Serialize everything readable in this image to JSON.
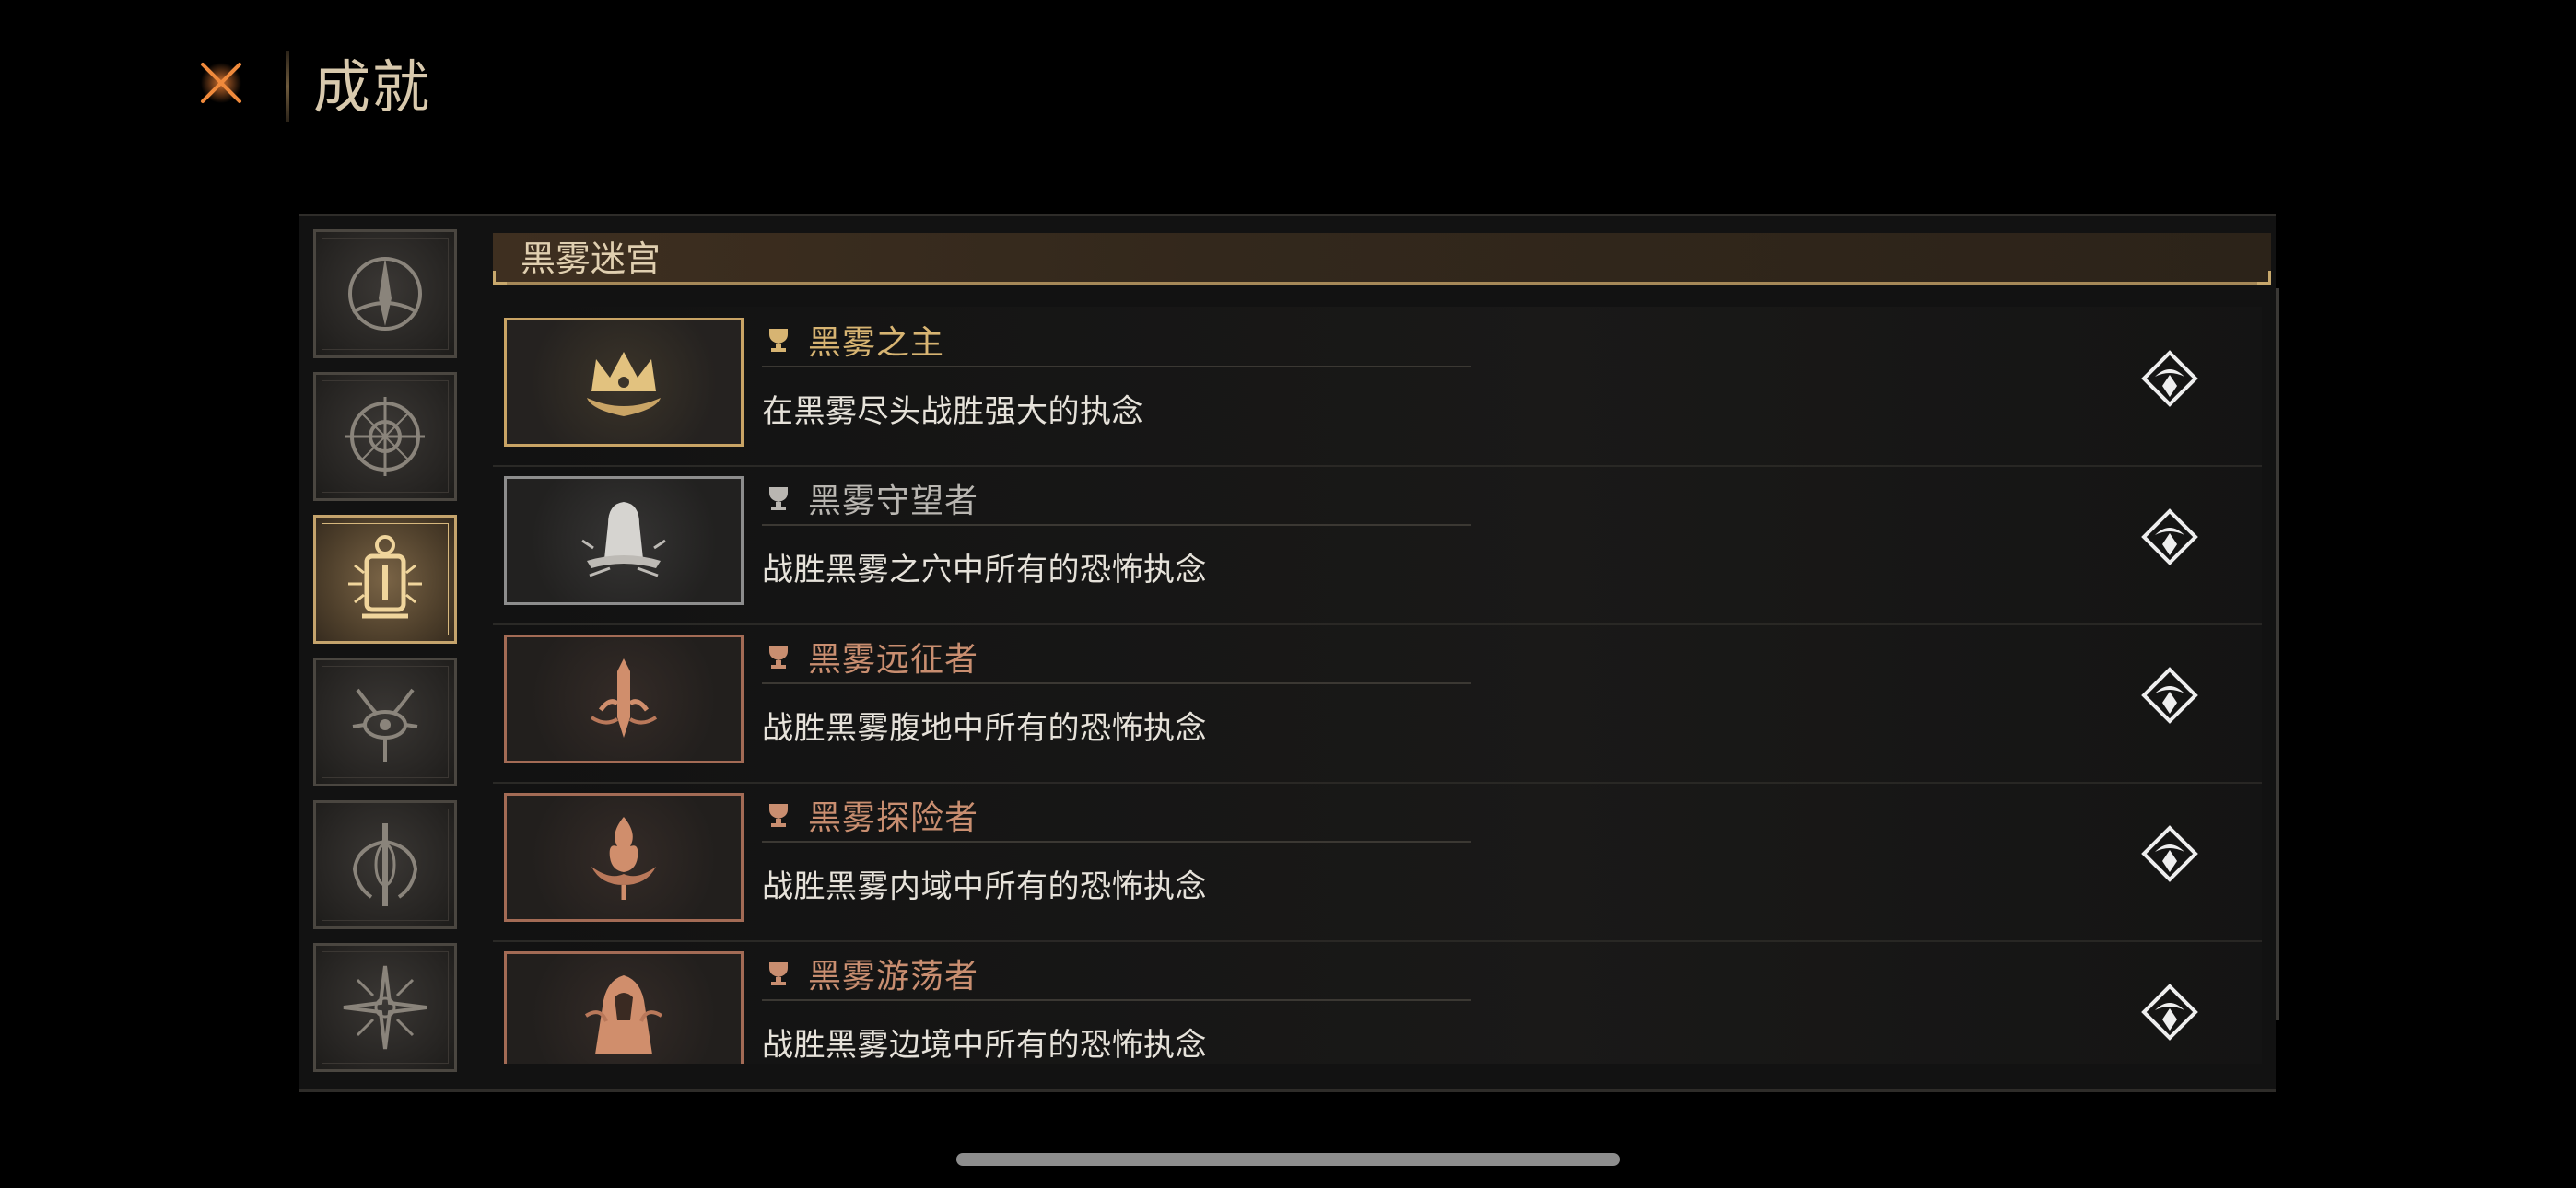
{
  "header": {
    "title": "成就",
    "close_icon": "close-x-icon"
  },
  "sidebar": {
    "categories": [
      {
        "icon": "arch-emblem-icon",
        "active": false
      },
      {
        "icon": "compass-emblem-icon",
        "active": false
      },
      {
        "icon": "lantern-emblem-icon",
        "active": true
      },
      {
        "icon": "horned-eye-emblem-icon",
        "active": false
      },
      {
        "icon": "tendril-emblem-icon",
        "active": false
      },
      {
        "icon": "thorn-star-emblem-icon",
        "active": false
      }
    ]
  },
  "section": {
    "title": "黑雾迷宫"
  },
  "achievements": [
    {
      "name": "黑雾之主",
      "desc": "在黑雾尽头战胜强大的执念",
      "tier": "gold",
      "icon": "crown-icon"
    },
    {
      "name": "黑雾守望者",
      "desc": "战胜黑雾之穴中所有的恐怖执念",
      "tier": "silver",
      "icon": "hooded-figure-icon"
    },
    {
      "name": "黑雾远征者",
      "desc": "战胜黑雾腹地中所有的恐怖执念",
      "tier": "bronze",
      "icon": "sword-icon"
    },
    {
      "name": "黑雾探险者",
      "desc": "战胜黑雾内域中所有的恐怖执念",
      "tier": "bronze",
      "icon": "flame-icon"
    },
    {
      "name": "黑雾游荡者",
      "desc": "战胜黑雾边境中所有的恐怖执念",
      "tier": "bronze",
      "icon": "cloaked-wanderer-icon"
    }
  ],
  "colors": {
    "gold": "#d7b472",
    "silver": "#b9b6b1",
    "bronze": "#c98e70",
    "background": "#000000"
  }
}
